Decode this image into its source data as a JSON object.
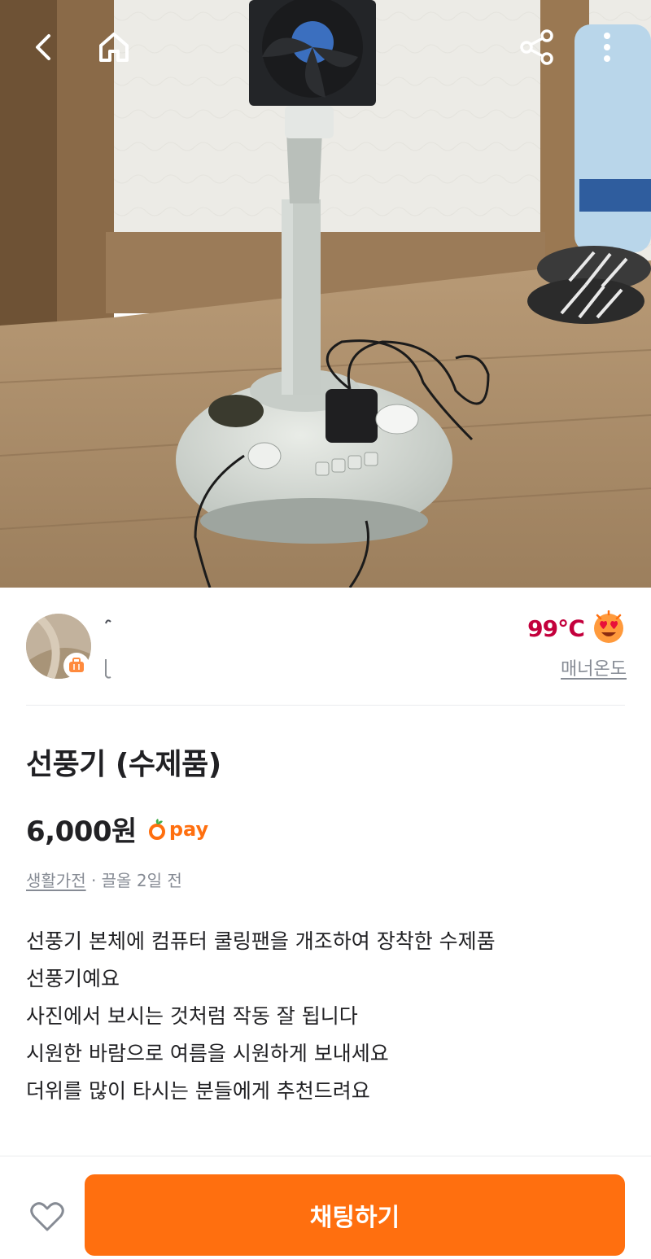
{
  "header": {
    "back_icon": "chevron-left-icon",
    "home_icon": "home-icon",
    "share_icon": "share-icon",
    "more_icon": "more-vertical-icon"
  },
  "photo": {
    "description_icon": "product-photo"
  },
  "seller": {
    "name": "",
    "location": "",
    "badge_icon": "suitcase-icon",
    "manner_temperature": "99℃",
    "manner_label": "매너온도",
    "emoji_icon": "heart-eyes-emoji-icon",
    "temperature_color": "#c3003c"
  },
  "product": {
    "title": "선풍기 (수제품)",
    "price": "6,000원",
    "pay_label": "pay",
    "category": "생활가전",
    "time_ago": " · 끌올 2일 전",
    "description": [
      "선풍기 본체에 컴퓨터 쿨링팬을 개조하여 장착한 수제품",
      "선풍기예요",
      "사진에서 보시는 것처럼 작동 잘 됩니다",
      "시원한 바람으로 여름을 시원하게 보내세요",
      "더위를 많이 타시는 분들에게 추천드려요"
    ]
  },
  "bottom_bar": {
    "chat_button_label": "채팅하기",
    "like_icon": "heart-outline-icon",
    "accent_color": "#ff6f0f"
  }
}
